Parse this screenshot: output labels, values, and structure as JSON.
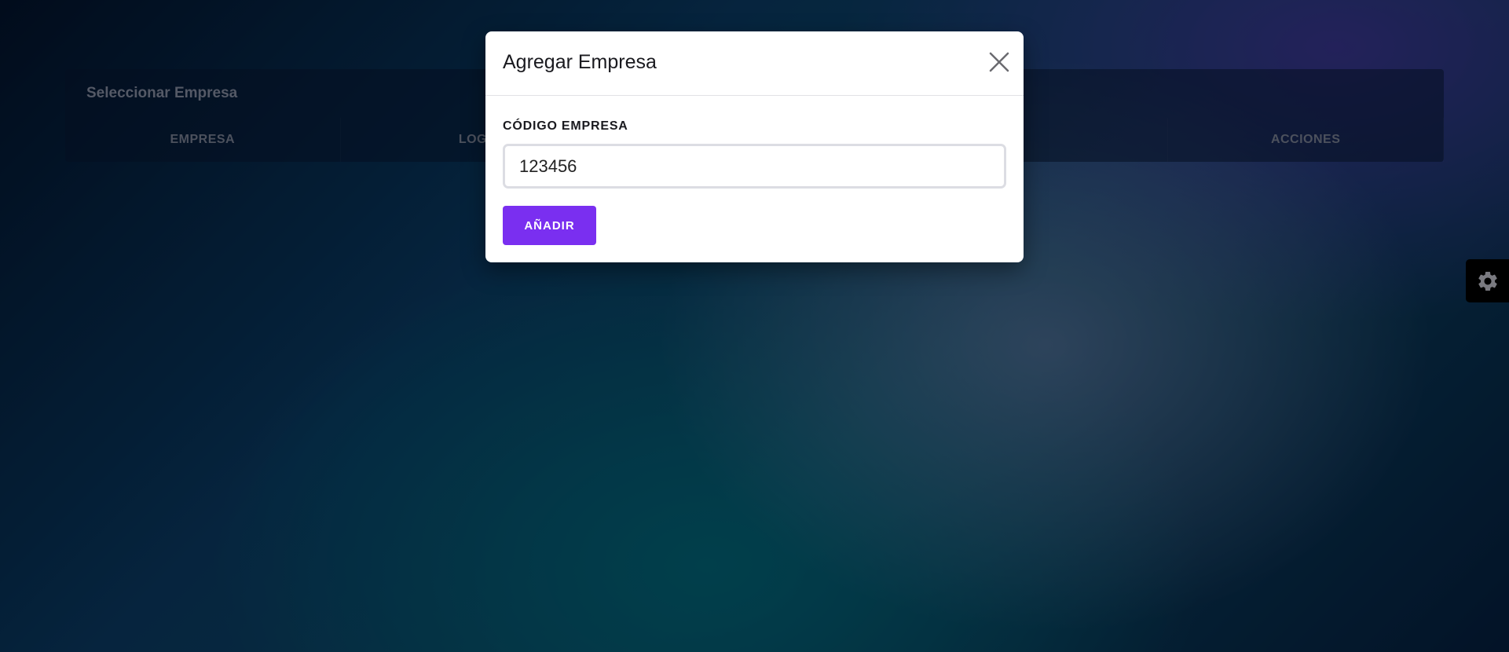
{
  "background_card": {
    "title": "Seleccionar Empresa",
    "columns": [
      "EMPRESA",
      "LOGO",
      "",
      "",
      "ACCIONES"
    ],
    "visible_partial_column": "O"
  },
  "settings": {
    "icon": "gear-icon"
  },
  "modal": {
    "title": "Agregar Empresa",
    "close_icon": "close-icon",
    "field_label": "CÓDIGO EMPRESA",
    "field_value": "123456",
    "submit_label": "AÑADIR",
    "accent_color": "#7a2ff0"
  }
}
